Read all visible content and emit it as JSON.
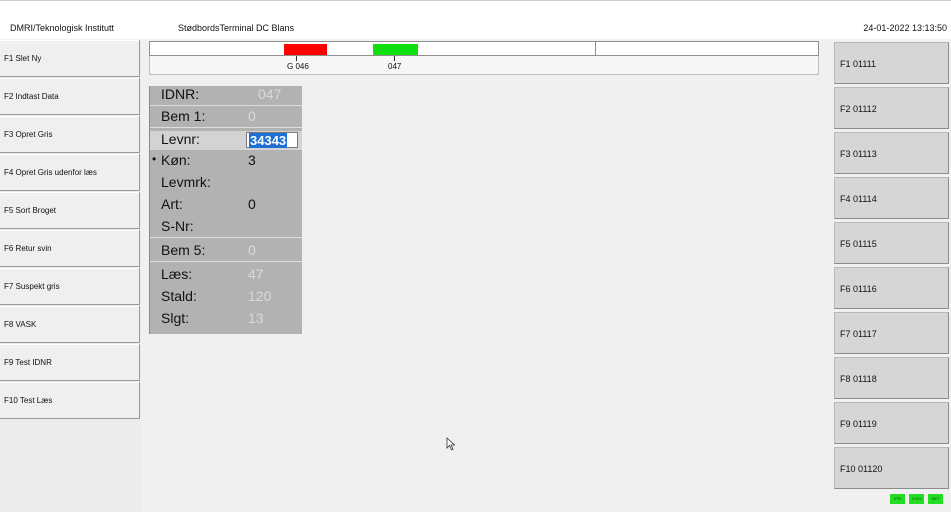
{
  "header": {
    "org": "DMRI/Teknologisk Institutt",
    "title": "StødbordsTerminal DC Blans",
    "datetime": "24-01-2022 13:13:50"
  },
  "left_buttons": [
    "F1 Slet Ny",
    "F2 Indtast Data",
    "F3 Opret Gris",
    "F4 Opret Gris udenfor læs",
    "F5 Sort Broget",
    "F6 Retur svin",
    "F7 Suspekt gris",
    "F8 VASK",
    "F9 Test IDNR",
    "F10 Test Læs"
  ],
  "ruler": {
    "label_1": "G 046",
    "label_2": "047",
    "red_color": "#ff0000",
    "green_color": "#10e010"
  },
  "panel": {
    "idnr": {
      "label": "IDNR:",
      "value": "047"
    },
    "bem1": {
      "label": "Bem 1:",
      "value": "0"
    },
    "levnr": {
      "label": "Levnr:",
      "value": "34343"
    },
    "kon": {
      "label": "Køn:",
      "value": "3"
    },
    "levmrk": {
      "label": "Levmrk:",
      "value": ""
    },
    "art": {
      "label": "Art:",
      "value": "0"
    },
    "snr": {
      "label": "S-Nr:",
      "value": ""
    },
    "bem5": {
      "label": "Bem 5:",
      "value": "0"
    },
    "laes": {
      "label": "Læs:",
      "value": "47"
    },
    "stald": {
      "label": "Stald:",
      "value": "120"
    },
    "slgt": {
      "label": "Slgt:",
      "value": "13"
    }
  },
  "right_buttons": [
    "F1 01111",
    "F2 01112",
    "F3 01113",
    "F4 01114",
    "F5 01115",
    "F6 01116",
    "F7 01117",
    "F8 01118",
    "F9 01119",
    "F10 01120"
  ],
  "status_indicators": [
    "IPN",
    "CON",
    "NET"
  ]
}
